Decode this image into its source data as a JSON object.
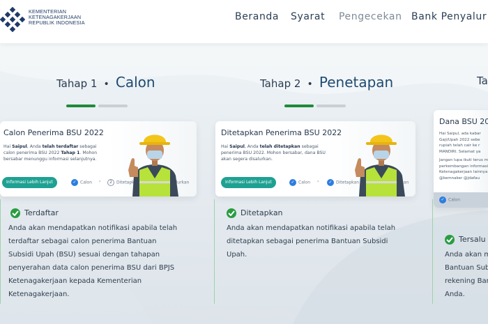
{
  "header": {
    "logo_lines": [
      "KEMENTERIAN",
      "KETENAGAKERJAAN",
      "REPUBLIK INDONESIA"
    ],
    "nav": [
      {
        "label": "Beranda",
        "active": true
      },
      {
        "label": "Syarat",
        "active": true
      },
      {
        "label": "Pengecekan",
        "active": false
      },
      {
        "label": "Bank Penyalur",
        "active": true
      }
    ]
  },
  "stages": [
    {
      "number": "Tahap 1",
      "separator": "•",
      "name": "Calon",
      "card": {
        "title": "Calon Penerima BSU 2022",
        "body_parts": [
          "Hai ",
          "Saipul",
          ", Anda ",
          "telah terdaftar",
          " sebagai calon penerima BSU 2022 ",
          "Tahap 1",
          ". Mohon bersabar menunggu informasi selanjutnya."
        ],
        "button": "Informasi Lebih Lanjut",
        "steps": [
          {
            "label": "Calon",
            "mark": "✓",
            "done": true
          },
          {
            "label": "Ditetapkan",
            "mark": "2",
            "done": false
          },
          {
            "label": "Tersalurkan",
            "mark": "3",
            "done": false
          }
        ]
      },
      "status": "Terdaftar",
      "description": "Anda akan mendapatkan notifikasi apabila telah terdaftar sebagai calon penerima Bantuan Subsidi Upah (BSU) sesuai dengan tahapan penyerahan data calon penerima BSU dari BPJS Ketenagakerjaan kepada Kementerian Ketenagakerjaan."
    },
    {
      "number": "Tahap 2",
      "separator": "•",
      "name": "Penetapan",
      "card": {
        "title": "Ditetapkan Penerima BSU 2022",
        "body_parts": [
          "Hai ",
          "Saipul",
          ", Anda ",
          "telah ditetapkan",
          " sebagai penerima BSU 2022. Mohon bersabar, dana BSU akan segera disalurkan.",
          "",
          ""
        ],
        "button": "Informasi Lebih Lanjut",
        "steps": [
          {
            "label": "Calon",
            "mark": "✓",
            "done": true
          },
          {
            "label": "Ditetapkan",
            "mark": "✓",
            "done": true
          },
          {
            "label": "Tersalurkan",
            "mark": "3",
            "done": false
          }
        ]
      },
      "status": "Ditetapkan",
      "description": "Anda akan mendapatkan notifikasi apabila telah ditetapkan sebagai penerima Bantuan Subsidi Upah."
    },
    {
      "number": "Tah",
      "card": {
        "title": "Dana BSU 2022",
        "body_lines": [
          "Hai Saipul, ada kabar",
          "Gaji/Upah 2022 sebe",
          "rupiah telah cair ke r",
          "MANDIRI. Selamat ya",
          "",
          "Jangan lupa ikuti terus m",
          "perkembangan informasi B",
          "Ketenagakerjaan lainnya",
          "@kemnaker  @jdafau"
        ],
        "steps": [
          {
            "label": "Calon",
            "mark": "✓",
            "done": true
          }
        ]
      },
      "status": "Tersalu",
      "description_lines": [
        "Anda akan m",
        "Bantuan Subsi",
        "rekening Ban",
        "Anda."
      ]
    }
  ],
  "colors": {
    "accent_green": "#1f8a3a",
    "button_teal": "#1ea192",
    "step_blue": "#2d7de0",
    "title_blue": "#1e4b72"
  }
}
